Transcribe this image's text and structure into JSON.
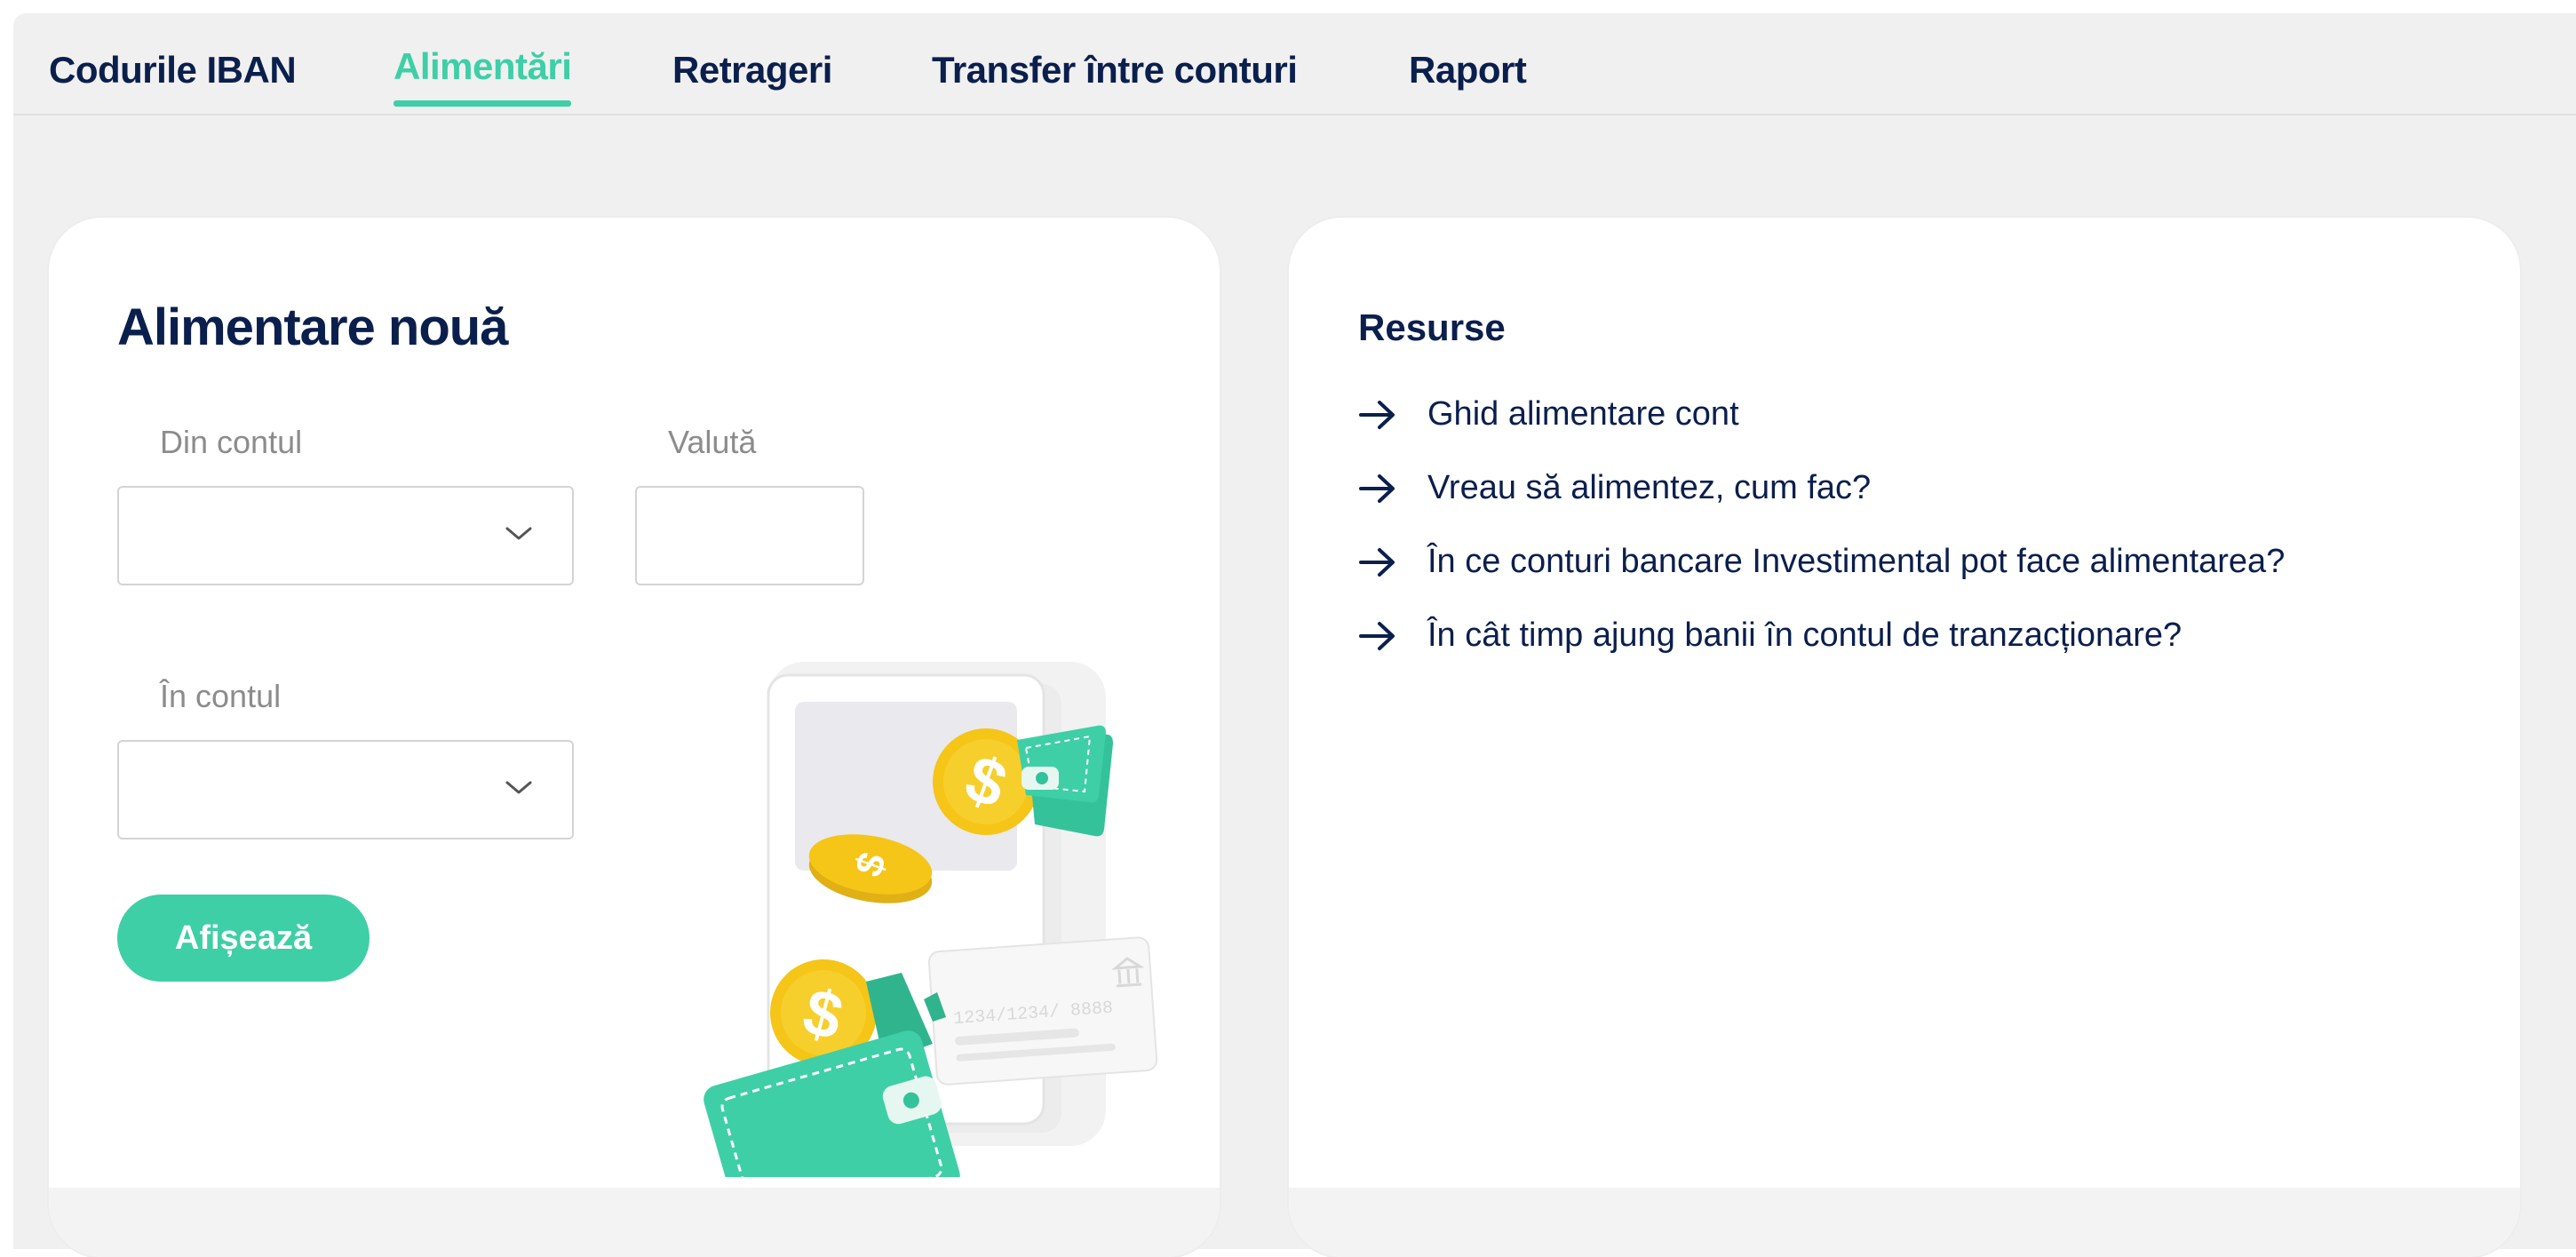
{
  "tabs": [
    {
      "label": "Codurile IBAN",
      "active": false
    },
    {
      "label": "Alimentări",
      "active": true
    },
    {
      "label": "Retrageri",
      "active": false
    },
    {
      "label": "Transfer între conturi",
      "active": false
    },
    {
      "label": "Raport",
      "active": false
    }
  ],
  "form": {
    "title": "Alimentare nouă",
    "from_account": {
      "label": "Din contul",
      "value": ""
    },
    "currency": {
      "label": "Valută",
      "value": ""
    },
    "to_account": {
      "label": "În contul",
      "value": ""
    },
    "submit_label": "Afișează"
  },
  "illustration": {
    "card_number": "1234/1234/ 8888",
    "icon": "wallet-coins-illustration"
  },
  "resources": {
    "title": "Resurse",
    "items": [
      "Ghid alimentare cont",
      "Vreau să alimentez, cum fac?",
      "În ce conturi bancare Investimental pot face alimentarea?",
      "În cât timp ajung banii în contul de tranzacționare?"
    ]
  },
  "colors": {
    "accent": "#3ecfa6",
    "navy": "#0b1f4d",
    "coin": "#f5c518",
    "background": "#f0f0f0"
  }
}
